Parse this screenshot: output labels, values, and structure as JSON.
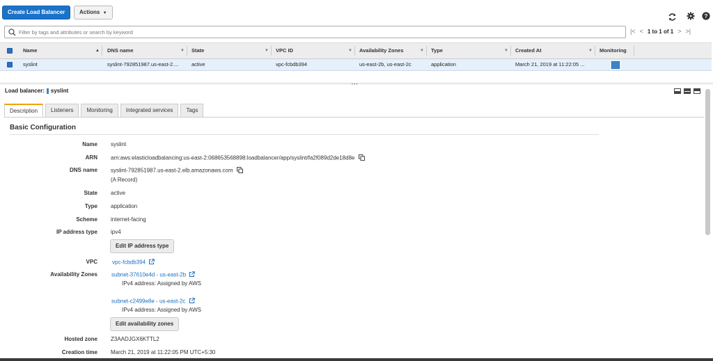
{
  "toolbar": {
    "create_label": "Create Load Balancer",
    "actions_label": "Actions"
  },
  "filter": {
    "placeholder": "Filter by tags and attributes or search by keyword"
  },
  "pagination": {
    "text": "1 to 1 of 1"
  },
  "table": {
    "columns": [
      "Name",
      "DNS name",
      "State",
      "VPC ID",
      "Availability Zones",
      "Type",
      "Created At",
      "Monitoring"
    ],
    "rows": [
      {
        "name": "syslint",
        "dns": "syslint-792851987.us-east-2....",
        "state": "active",
        "vpc": "vpc-fcbdb394",
        "zones": "us-east-2b, us-east-2c",
        "type": "application",
        "created": "March 21, 2019 at 11:22:05 ..."
      }
    ]
  },
  "detail": {
    "header_label": "Load balancer:",
    "header_name": "syslint",
    "tabs": [
      "Description",
      "Listeners",
      "Monitoring",
      "Integrated services",
      "Tags"
    ],
    "section_title": "Basic Configuration",
    "name_label": "Name",
    "name_value": "syslint",
    "arn_label": "ARN",
    "arn_value": "arn:aws:elasticloadbalancing:us-east-2:068653568898:loadbalancer/app/syslint/fa2f089d2de18d8e",
    "dns_label": "DNS name",
    "dns_value": "syslint-792851987.us-east-2.elb.amazonaws.com",
    "dns_record": "(A Record)",
    "state_label": "State",
    "state_value": "active",
    "type_label": "Type",
    "type_value": "application",
    "scheme_label": "Scheme",
    "scheme_value": "internet-facing",
    "ip_label": "IP address type",
    "ip_value": "ipv4",
    "edit_ip_label": "Edit IP address type",
    "vpc_label": "VPC",
    "vpc_value": "vpc-fcbdb394",
    "az_label": "Availability Zones",
    "az1_link": "subnet-37610e4d - us-east-2b",
    "az1_sub": "IPv4 address: Assigned by AWS",
    "az2_link": "subnet-c2499e8e - us-east-2c",
    "az2_sub": "IPv4 address: Assigned by AWS",
    "edit_az_label": "Edit availability zones",
    "hz_label": "Hosted zone",
    "hz_value": "Z3AADJGX6KTTL2",
    "ct_label": "Creation time",
    "ct_value": "March 21, 2019 at 11:22:05 PM UTC+5:30"
  },
  "colors": {
    "primary": "#1a73c8",
    "link": "#1a6ec0",
    "selected_row": "#e6f0fb",
    "tab_accent": "#f0a000"
  }
}
